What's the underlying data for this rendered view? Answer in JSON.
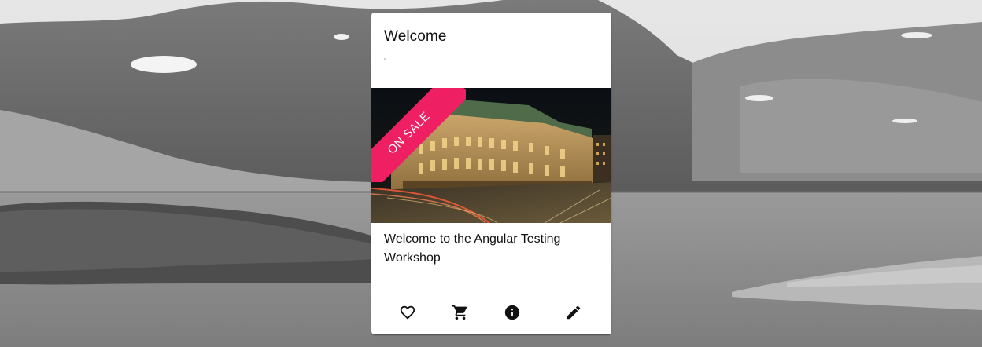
{
  "card": {
    "title": "Welcome",
    "badge": "ON SALE",
    "description": "Welcome to the Angular Testing Workshop",
    "actions": [
      {
        "icon": "heart-outline-icon"
      },
      {
        "icon": "shopping-cart-icon"
      },
      {
        "icon": "info-icon"
      },
      {
        "icon": "edit-pencil-icon"
      }
    ]
  },
  "colors": {
    "badge": "#ee1f63",
    "card_background": "#ffffff",
    "text": "#111111"
  }
}
